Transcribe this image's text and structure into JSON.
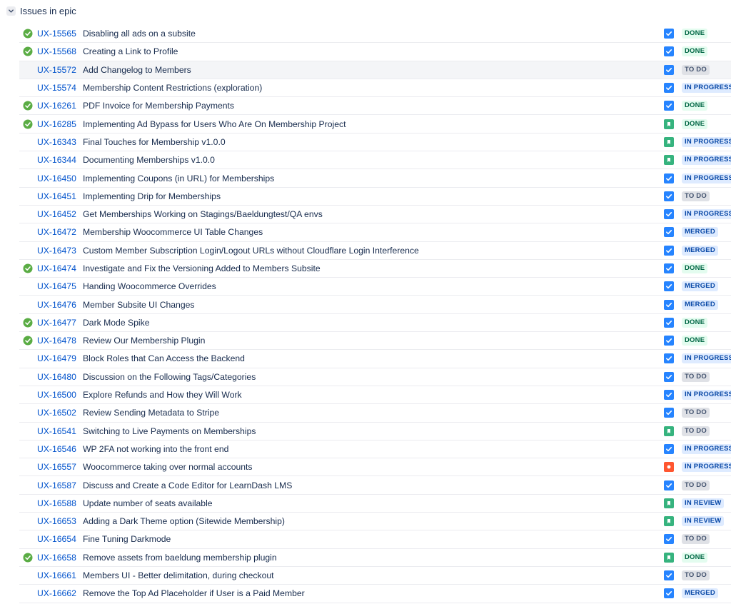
{
  "section": {
    "title": "Issues in epic",
    "toggle_icon": "chevron-down-icon"
  },
  "colors": {
    "link": "#0052cc",
    "task": "#2684ff",
    "story": "#36b37e",
    "bug": "#ff5630",
    "resolved": "#5aac44"
  },
  "issues": [
    {
      "key": "UX-15565",
      "summary": "Disabling all ads on a subsite",
      "resolved": true,
      "type": "task",
      "status": "DONE"
    },
    {
      "key": "UX-15568",
      "summary": "Creating a Link to Profile",
      "resolved": true,
      "type": "task",
      "status": "DONE"
    },
    {
      "key": "UX-15572",
      "summary": "Add Changelog to Members",
      "resolved": false,
      "type": "task",
      "status": "TO DO",
      "highlighted": true
    },
    {
      "key": "UX-15574",
      "summary": "Membership Content Restrictions (exploration)",
      "resolved": false,
      "type": "task",
      "status": "IN PROGRESS"
    },
    {
      "key": "UX-16261",
      "summary": "PDF Invoice for Membership Payments",
      "resolved": true,
      "type": "task",
      "status": "DONE"
    },
    {
      "key": "UX-16285",
      "summary": "Implementing Ad Bypass for Users Who Are On Membership Project",
      "resolved": true,
      "type": "story",
      "status": "DONE"
    },
    {
      "key": "UX-16343",
      "summary": "Final Touches for Membership v1.0.0",
      "resolved": false,
      "type": "story",
      "status": "IN PROGRESS"
    },
    {
      "key": "UX-16344",
      "summary": "Documenting Memberships v1.0.0",
      "resolved": false,
      "type": "story",
      "status": "IN PROGRESS"
    },
    {
      "key": "UX-16450",
      "summary": "Implementing Coupons (in URL) for Memberships",
      "resolved": false,
      "type": "task",
      "status": "IN PROGRESS"
    },
    {
      "key": "UX-16451",
      "summary": "Implementing Drip for Memberships",
      "resolved": false,
      "type": "task",
      "status": "TO DO"
    },
    {
      "key": "UX-16452",
      "summary": "Get Memberships Working on Stagings/Baeldungtest/QA envs",
      "resolved": false,
      "type": "task",
      "status": "IN PROGRESS"
    },
    {
      "key": "UX-16472",
      "summary": "Membership Woocommerce UI Table Changes",
      "resolved": false,
      "type": "task",
      "status": "MERGED"
    },
    {
      "key": "UX-16473",
      "summary": "Custom Member Subscription Login/Logout URLs without Cloudflare Login Interference",
      "resolved": false,
      "type": "task",
      "status": "MERGED"
    },
    {
      "key": "UX-16474",
      "summary": "Investigate and Fix the Versioning Added to Members Subsite",
      "resolved": true,
      "type": "task",
      "status": "DONE"
    },
    {
      "key": "UX-16475",
      "summary": "Handing Woocommerce Overrides",
      "resolved": false,
      "type": "task",
      "status": "MERGED"
    },
    {
      "key": "UX-16476",
      "summary": "Member Subsite UI Changes",
      "resolved": false,
      "type": "task",
      "status": "MERGED"
    },
    {
      "key": "UX-16477",
      "summary": "Dark Mode Spike",
      "resolved": true,
      "type": "task",
      "status": "DONE"
    },
    {
      "key": "UX-16478",
      "summary": "Review Our Membership Plugin",
      "resolved": true,
      "type": "task",
      "status": "DONE"
    },
    {
      "key": "UX-16479",
      "summary": "Block Roles that Can Access the Backend",
      "resolved": false,
      "type": "task",
      "status": "IN PROGRESS"
    },
    {
      "key": "UX-16480",
      "summary": "Discussion on the Following Tags/Categories",
      "resolved": false,
      "type": "task",
      "status": "TO DO"
    },
    {
      "key": "UX-16500",
      "summary": "Explore Refunds and How they Will Work",
      "resolved": false,
      "type": "task",
      "status": "IN PROGRESS"
    },
    {
      "key": "UX-16502",
      "summary": "Review Sending Metadata to Stripe",
      "resolved": false,
      "type": "task",
      "status": "TO DO"
    },
    {
      "key": "UX-16541",
      "summary": "Switching to Live Payments on Memberships",
      "resolved": false,
      "type": "story",
      "status": "TO DO"
    },
    {
      "key": "UX-16546",
      "summary": "WP 2FA not working into the front end",
      "resolved": false,
      "type": "task",
      "status": "IN PROGRESS"
    },
    {
      "key": "UX-16557",
      "summary": "Woocommerce taking over normal accounts",
      "resolved": false,
      "type": "bug",
      "status": "IN PROGRESS"
    },
    {
      "key": "UX-16587",
      "summary": "Discuss and Create a Code Editor for LearnDash LMS",
      "resolved": false,
      "type": "task",
      "status": "TO DO"
    },
    {
      "key": "UX-16588",
      "summary": "Update number of seats available",
      "resolved": false,
      "type": "story",
      "status": "IN REVIEW"
    },
    {
      "key": "UX-16653",
      "summary": "Adding a Dark Theme option (Sitewide Membership)",
      "resolved": false,
      "type": "story",
      "status": "IN REVIEW"
    },
    {
      "key": "UX-16654",
      "summary": "Fine Tuning Darkmode",
      "resolved": false,
      "type": "task",
      "status": "TO DO"
    },
    {
      "key": "UX-16658",
      "summary": "Remove assets from baeldung membership plugin",
      "resolved": true,
      "type": "story",
      "status": "DONE"
    },
    {
      "key": "UX-16661",
      "summary": "Members UI - Better delimitation, during checkout",
      "resolved": false,
      "type": "task",
      "status": "TO DO"
    },
    {
      "key": "UX-16662",
      "summary": "Remove the Top Ad Placeholder if User is a Paid Member",
      "resolved": false,
      "type": "task",
      "status": "MERGED"
    }
  ]
}
